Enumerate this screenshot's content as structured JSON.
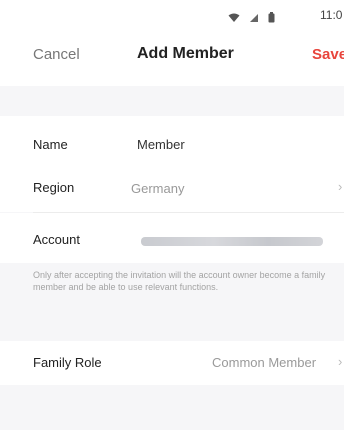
{
  "status_bar": {
    "time": "11:0",
    "icons": [
      "wifi-icon",
      "signal-icon",
      "battery-icon"
    ]
  },
  "nav": {
    "cancel_label": "Cancel",
    "title": "Add Member",
    "save_label": "Save"
  },
  "form": {
    "name": {
      "label": "Name",
      "value": "Member"
    },
    "region": {
      "label": "Region",
      "value": "Germany"
    },
    "account": {
      "label": "Account"
    },
    "note": "Only after accepting the invitation will the account owner become a family member and be able to use relevant functions.",
    "family_role": {
      "label": "Family Role",
      "value": "Common Member"
    }
  },
  "colors": {
    "accent": "#e8453c",
    "background": "#f6f6f8",
    "muted_text": "#999999"
  }
}
